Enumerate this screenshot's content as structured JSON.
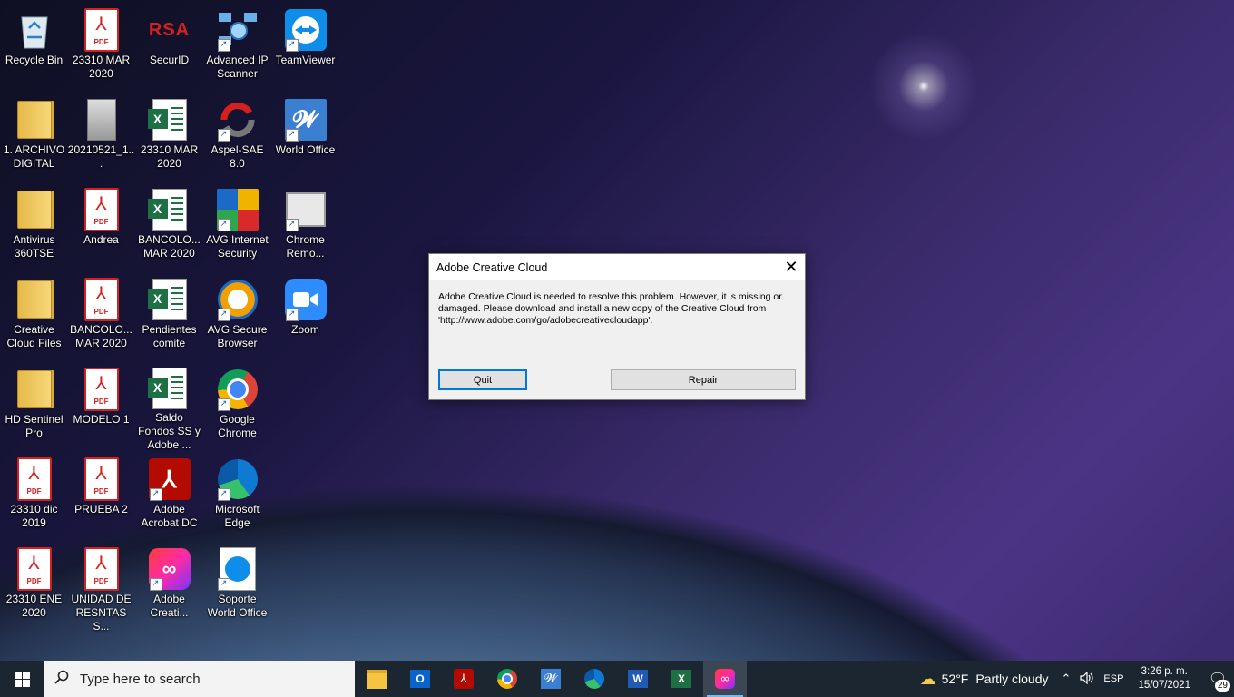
{
  "desktop_icons": [
    {
      "label": "Recycle Bin",
      "glyph": "recycle-bin-icon"
    },
    {
      "label": "23310 MAR 2020",
      "glyph": "pdf-icon"
    },
    {
      "label": "SecurID",
      "glyph": "rsa-securid-icon",
      "logo_text": "RSA"
    },
    {
      "label": "Advanced IP Scanner",
      "glyph": "network-scanner-icon"
    },
    {
      "label": "TeamViewer",
      "glyph": "teamviewer-icon"
    },
    {
      "label": "1. ARCHIVO DIGITAL",
      "glyph": "folder-icon"
    },
    {
      "label": "20210521_1...",
      "glyph": "image-file-icon"
    },
    {
      "label": "23310 MAR 2020",
      "glyph": "excel-file-icon"
    },
    {
      "label": "Aspel-SAE 8.0",
      "glyph": "aspel-sae-icon"
    },
    {
      "label": "World Office",
      "glyph": "world-office-icon"
    },
    {
      "label": "Antivirus 360TSE",
      "glyph": "folder-icon"
    },
    {
      "label": "Andrea",
      "glyph": "pdf-icon"
    },
    {
      "label": "BANCOLO... MAR 2020",
      "glyph": "excel-file-icon"
    },
    {
      "label": "AVG Internet Security",
      "glyph": "avg-icon"
    },
    {
      "label": "Chrome Remo...",
      "glyph": "chrome-remote-icon"
    },
    {
      "label": "Creative Cloud Files",
      "glyph": "folder-icon"
    },
    {
      "label": "BANCOLO... MAR 2020",
      "glyph": "pdf-icon"
    },
    {
      "label": "Pendientes comite",
      "glyph": "excel-file-icon"
    },
    {
      "label": "AVG Secure Browser",
      "glyph": "avg-browser-icon"
    },
    {
      "label": "Zoom",
      "glyph": "zoom-icon"
    },
    {
      "label": "HD Sentinel Pro",
      "glyph": "folder-icon"
    },
    {
      "label": "MODELO 1",
      "glyph": "pdf-icon"
    },
    {
      "label": "Saldo Fondos SS y Adobe ...",
      "glyph": "excel-file-icon"
    },
    {
      "label": "Google Chrome",
      "glyph": "chrome-icon"
    },
    {
      "label": "23310 dic 2019",
      "glyph": "pdf-icon"
    },
    {
      "label": "PRUEBA 2",
      "glyph": "pdf-icon"
    },
    {
      "label": "Adobe Acrobat DC",
      "glyph": "acrobat-icon"
    },
    {
      "label": "Microsoft Edge",
      "glyph": "edge-icon"
    },
    {
      "label": "23310 ENE 2020",
      "glyph": "pdf-icon"
    },
    {
      "label": "UNIDAD DE RESNTAS S...",
      "glyph": "pdf-icon"
    },
    {
      "label": "Adobe Creati...",
      "glyph": "creative-cloud-icon"
    },
    {
      "label": "Soporte World Office",
      "glyph": "teamviewer-qs-icon"
    }
  ],
  "pdf_tag": "PDF",
  "dialog": {
    "title": "Adobe Creative Cloud",
    "message": "Adobe Creative Cloud is needed to resolve this problem.  However, it is missing or damaged. Please download and install a new copy of the Creative Cloud from 'http://www.adobe.com/go/adobecreativecloudapp'.",
    "quit_label": "Quit",
    "repair_label": "Repair",
    "close_glyph": "✕"
  },
  "taskbar": {
    "search_placeholder": "Type here to search",
    "apps": [
      "file-explorer-icon",
      "outlook-icon",
      "acrobat-icon",
      "chrome-icon",
      "world-office-icon",
      "edge-icon",
      "word-icon",
      "excel-icon",
      "creative-cloud-icon"
    ],
    "weather_temp": "52°F",
    "weather_desc": "Partly cloudy",
    "language": "ESP",
    "time": "3:26 p. m.",
    "date": "15/07/2021",
    "notification_count": "29"
  }
}
